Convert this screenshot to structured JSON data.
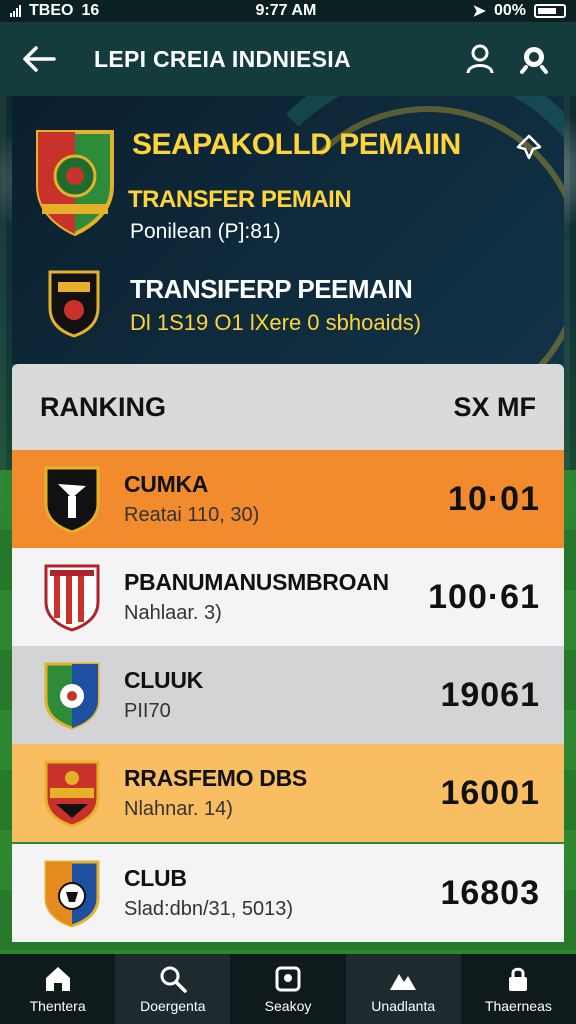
{
  "status_bar": {
    "left_text": "TBEO",
    "left_extra": "16",
    "time": "9:77 AM",
    "battery": "00%"
  },
  "header": {
    "title": "LEPI CREIA INDNIESIA",
    "back_icon": "arrow-left-icon",
    "profile_icon": "user-icon",
    "search_icon": "search-icon"
  },
  "hero": {
    "title": "SEAPAKOLLD PEMAIIN",
    "subtitle": "TRANSFER PEMAIN",
    "detail": "Ponilean (P]:81)",
    "second_title": "TRANSIFERP PEEMAIN",
    "second_detail": "Dl 1S19 O1 lXere 0 sbhoaids)"
  },
  "ranking": {
    "header_left": "RANKING",
    "header_right": "SX MF",
    "rows": [
      {
        "name": "CUMKA",
        "sub": "Reatai 110, 30)",
        "score": "10·01",
        "bg": "#f28b2e"
      },
      {
        "name": "PBANUMANUSMBROAN",
        "sub": "Nahlaar. 3)",
        "score": "100·61",
        "bg": "#f4f4f4"
      },
      {
        "name": "CLUUK",
        "sub": "PII70",
        "score": "19061",
        "bg": "#d3d4d6"
      },
      {
        "name": "RRASFEMO DBS",
        "sub": "Nlahnar. 14)",
        "score": "16001",
        "bg": "#f9be62"
      },
      {
        "name": "CLUB",
        "sub": "Slad:dbn/31, 5013)",
        "score": "16803",
        "bg": "#f4f4f4"
      }
    ]
  },
  "bottom_nav": [
    {
      "label": "Thentera",
      "icon": "home-icon"
    },
    {
      "label": "Doergenta",
      "icon": "search-icon"
    },
    {
      "label": "Seakoy",
      "icon": "square-icon"
    },
    {
      "label": "Unadlanta",
      "icon": "mountain-icon"
    },
    {
      "label": "Thaerneas",
      "icon": "lock-icon"
    }
  ]
}
